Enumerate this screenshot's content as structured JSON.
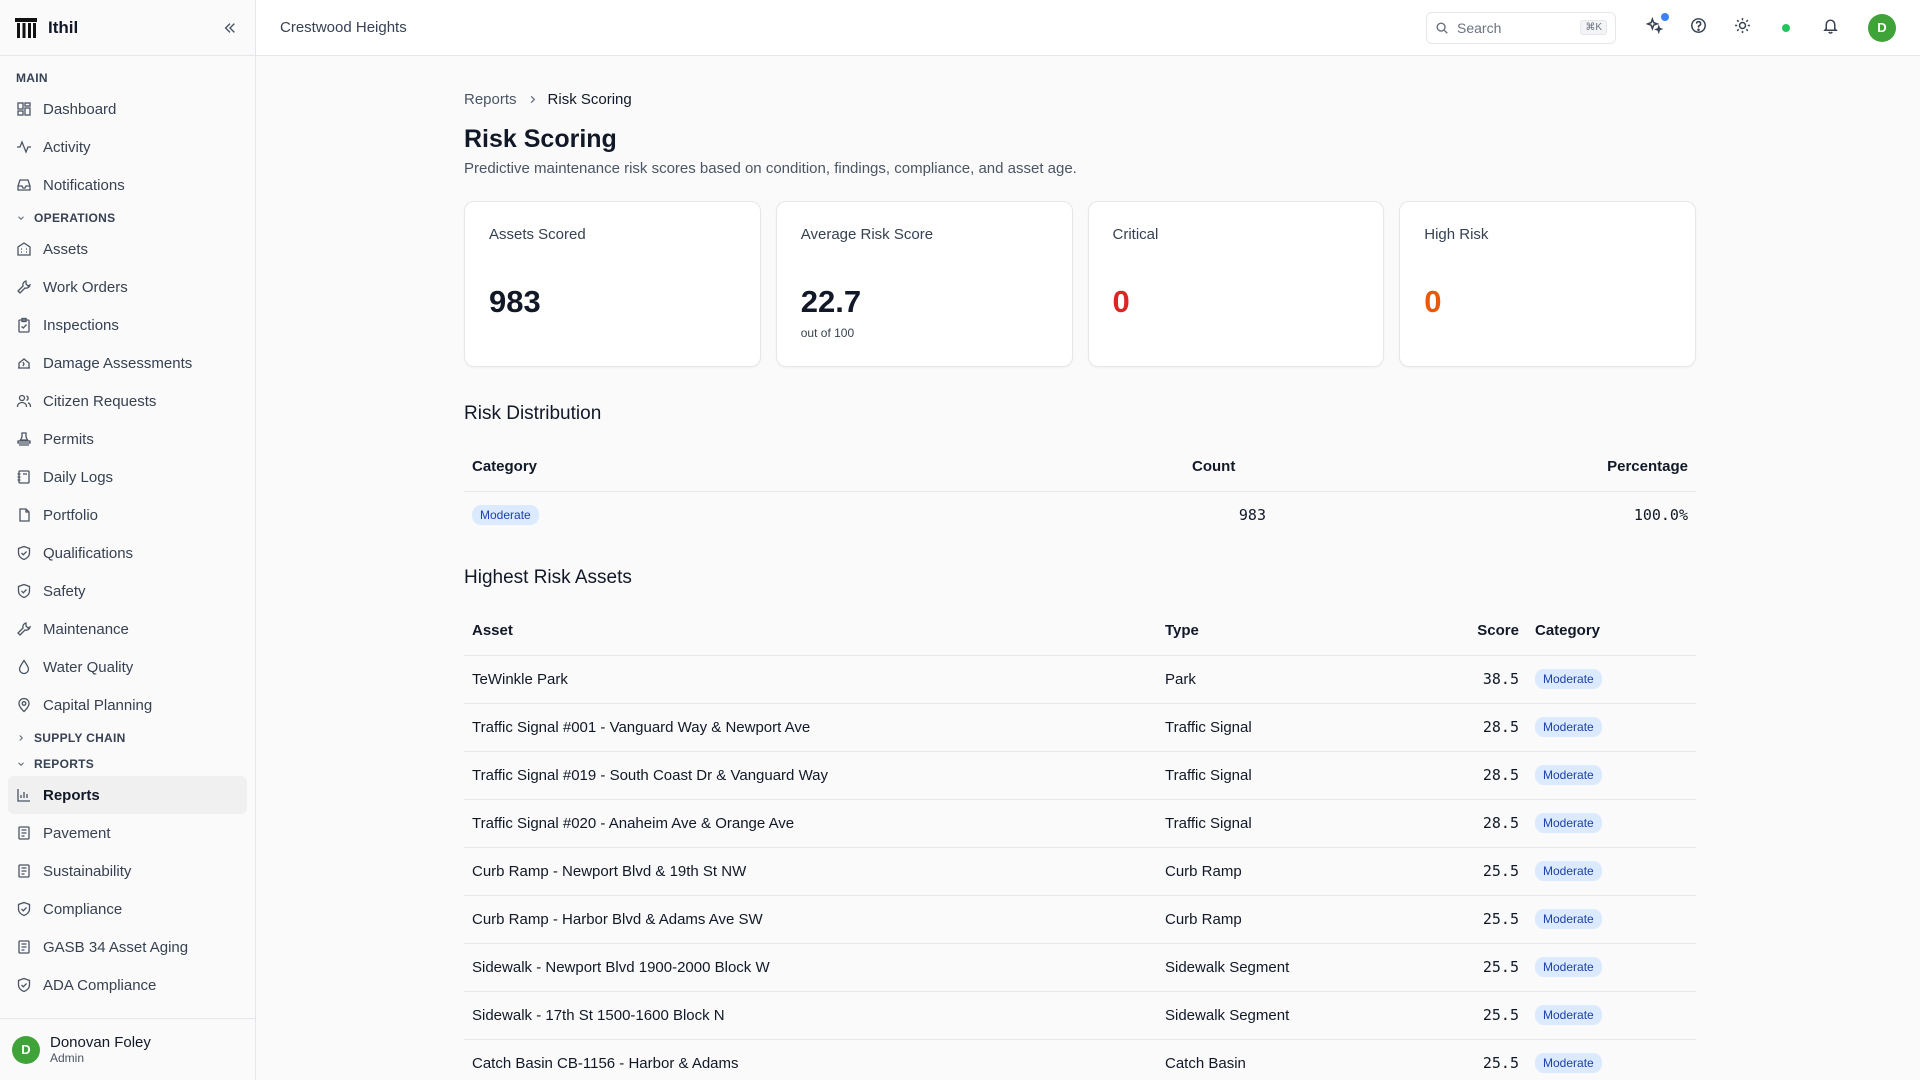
{
  "brand": {
    "name": "Ithil"
  },
  "sidebar": {
    "main_label": "MAIN",
    "main_items": [
      {
        "label": "Dashboard",
        "icon": "dashboard-icon"
      },
      {
        "label": "Activity",
        "icon": "activity-icon"
      },
      {
        "label": "Notifications",
        "icon": "inbox-icon"
      }
    ],
    "operations_label": "OPERATIONS",
    "operations_items": [
      {
        "label": "Assets"
      },
      {
        "label": "Work Orders"
      },
      {
        "label": "Inspections"
      },
      {
        "label": "Damage Assessments"
      },
      {
        "label": "Citizen Requests"
      },
      {
        "label": "Permits"
      },
      {
        "label": "Daily Logs"
      },
      {
        "label": "Portfolio"
      },
      {
        "label": "Qualifications"
      },
      {
        "label": "Safety"
      },
      {
        "label": "Maintenance"
      },
      {
        "label": "Water Quality"
      },
      {
        "label": "Capital Planning"
      }
    ],
    "supply_chain_label": "SUPPLY CHAIN",
    "reports_label": "REPORTS",
    "reports_items": [
      {
        "label": "Reports"
      },
      {
        "label": "Pavement"
      },
      {
        "label": "Sustainability"
      },
      {
        "label": "Compliance"
      },
      {
        "label": "GASB 34 Asset Aging"
      },
      {
        "label": "ADA Compliance"
      }
    ]
  },
  "user": {
    "initial": "D",
    "name": "Donovan Foley",
    "role": "Admin"
  },
  "topbar": {
    "org": "Crestwood Heights",
    "search_label": "Search",
    "search_shortcut": "⌘K",
    "avatar_initial": "D"
  },
  "breadcrumb": {
    "parent": "Reports",
    "current": "Risk Scoring"
  },
  "page": {
    "title": "Risk Scoring",
    "description": "Predictive maintenance risk scores based on condition, findings, compliance, and asset age."
  },
  "cards": [
    {
      "label": "Assets Scored",
      "value": "983",
      "sub": ""
    },
    {
      "label": "Average Risk Score",
      "value": "22.7",
      "sub": "out of 100"
    },
    {
      "label": "Critical",
      "value": "0",
      "sub": ""
    },
    {
      "label": "High Risk",
      "value": "0",
      "sub": ""
    }
  ],
  "distribution": {
    "title": "Risk Distribution",
    "headers": {
      "category": "Category",
      "count": "Count",
      "percentage": "Percentage"
    },
    "rows": [
      {
        "category": "Moderate",
        "count": "983",
        "percentage": "100.0%"
      }
    ]
  },
  "highest": {
    "title": "Highest Risk Assets",
    "headers": {
      "asset": "Asset",
      "type": "Type",
      "score": "Score",
      "category": "Category"
    },
    "rows": [
      {
        "asset": "TeWinkle Park",
        "type": "Park",
        "score": "38.5",
        "category": "Moderate"
      },
      {
        "asset": "Traffic Signal #001 - Vanguard Way & Newport Ave",
        "type": "Traffic Signal",
        "score": "28.5",
        "category": "Moderate"
      },
      {
        "asset": "Traffic Signal #019 - South Coast Dr & Vanguard Way",
        "type": "Traffic Signal",
        "score": "28.5",
        "category": "Moderate"
      },
      {
        "asset": "Traffic Signal #020 - Anaheim Ave & Orange Ave",
        "type": "Traffic Signal",
        "score": "28.5",
        "category": "Moderate"
      },
      {
        "asset": "Curb Ramp - Newport Blvd & 19th St NW",
        "type": "Curb Ramp",
        "score": "25.5",
        "category": "Moderate"
      },
      {
        "asset": "Curb Ramp - Harbor Blvd & Adams Ave SW",
        "type": "Curb Ramp",
        "score": "25.5",
        "category": "Moderate"
      },
      {
        "asset": "Sidewalk - Newport Blvd 1900-2000 Block W",
        "type": "Sidewalk Segment",
        "score": "25.5",
        "category": "Moderate"
      },
      {
        "asset": "Sidewalk - 17th St 1500-1600 Block N",
        "type": "Sidewalk Segment",
        "score": "25.5",
        "category": "Moderate"
      },
      {
        "asset": "Catch Basin CB-1156 - Harbor & Adams",
        "type": "Catch Basin",
        "score": "25.5",
        "category": "Moderate"
      }
    ]
  },
  "colors": {
    "accent_green": "#3fa33a",
    "critical_red": "#dc2626",
    "high_orange": "#ea580c",
    "badge_bg": "#dbeafe",
    "badge_text": "#1e40af"
  }
}
